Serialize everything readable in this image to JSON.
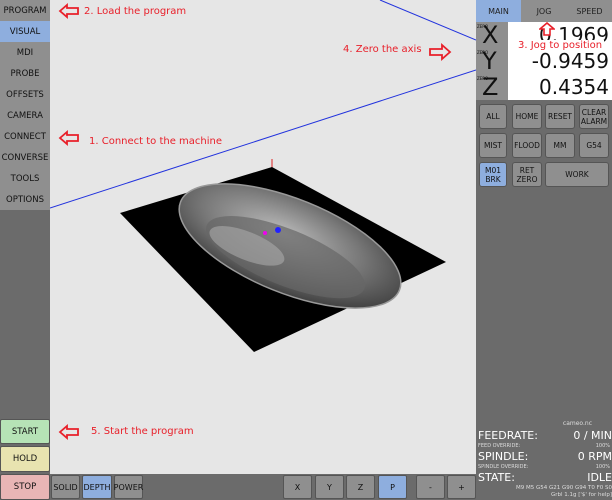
{
  "sidebar": {
    "items": [
      {
        "label": "PROGRAM",
        "active": false
      },
      {
        "label": "VISUAL",
        "active": true
      },
      {
        "label": "MDI",
        "active": false
      },
      {
        "label": "PROBE",
        "active": false
      },
      {
        "label": "OFFSETS",
        "active": false
      },
      {
        "label": "CAMERA",
        "active": false
      },
      {
        "label": "CONNECT",
        "active": false
      },
      {
        "label": "CONVERSE",
        "active": false
      },
      {
        "label": "TOOLS",
        "active": false
      },
      {
        "label": "OPTIONS",
        "active": false
      }
    ],
    "start": "START",
    "hold": "HOLD",
    "stop": "STOP"
  },
  "bottombar": {
    "solid": "SOLID",
    "depth": "DEPTH",
    "power": "POWER",
    "x": "X",
    "y": "Y",
    "z": "Z",
    "p": "P",
    "minus": "-",
    "plus": "+"
  },
  "tabs": [
    "MAIN",
    "JOG",
    "SPEED"
  ],
  "dro": {
    "zero_label": "ZERO",
    "x": {
      "axis": "X",
      "value": "0.1969"
    },
    "y": {
      "axis": "Y",
      "value": "-0.9459"
    },
    "z": {
      "axis": "Z",
      "value": "0.4354"
    }
  },
  "buttons": {
    "zero_all": "ALL",
    "home": "HOME",
    "reset": "RESET",
    "clear_alarm": "CLEAR ALARM",
    "mist": "MIST",
    "flood": "FLOOD",
    "mm": "MM",
    "g54": "G54",
    "m01": "M01 BRK",
    "ret_zero": "RET ZERO",
    "work": "WORK"
  },
  "status": {
    "file": "cameo.nc",
    "feedrate_label": "FEEDRATE:",
    "feedrate": "0 / MIN",
    "feed_override_label": "FEED OVERRIDE:",
    "feed_override": "100%",
    "spindle_label": "SPINDLE:",
    "spindle": "0 RPM",
    "spindle_override_label": "SPINDLE OVERRIDE:",
    "spindle_override": "100%",
    "state_label": "STATE:",
    "state": "IDLE",
    "gcodes": "M9 M5 G54 G21 G90 G94 T0 F0 S0",
    "grbl": "Grbl 1.1g ['$' for help]"
  },
  "annotations": {
    "a1": "1. Connect to the machine",
    "a2": "2. Load the program",
    "a3": "3. Jog to position",
    "a4": "4. Zero the axis",
    "a5": "5. Start the program"
  },
  "colors": {
    "active": "#8eaede",
    "start": "#b6e3b6",
    "hold": "#e8e3b0",
    "stop": "#e8b5b5",
    "annotation": "#e8202a"
  }
}
